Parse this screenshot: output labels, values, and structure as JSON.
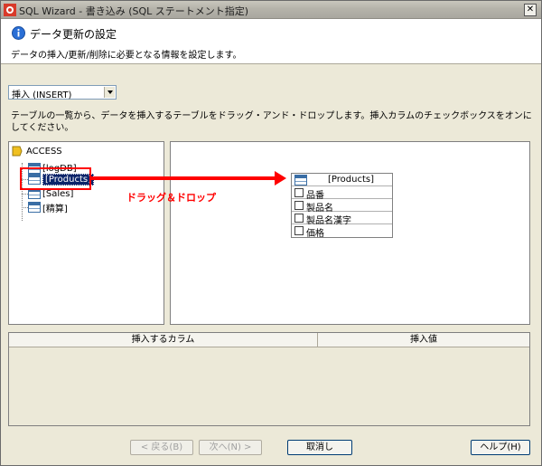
{
  "window": {
    "title": "SQL Wizard - 書き込み (SQL ステートメント指定)",
    "close_label": "✕"
  },
  "header": {
    "heading": "データ更新の設定",
    "description": "データの挿入/更新/削除に必要となる情報を設定します。"
  },
  "operation": {
    "selected": "挿入 (INSERT)"
  },
  "instructions": "テーブルの一覧から、データを挿入するテーブルをドラッグ・アンド・ドロップします。挿入カラムのチェックボックスをオンにしてください。",
  "tree": {
    "root": "ACCESS",
    "items": [
      {
        "label": "[logDB]"
      },
      {
        "label": "[Products]",
        "selected": true
      },
      {
        "label": "[Sales]"
      },
      {
        "label": "[精算]"
      }
    ]
  },
  "annotation": {
    "label": "ドラッグ＆ドロップ",
    "color": "#ff0000"
  },
  "table_box": {
    "title": "[Products]",
    "columns": [
      "品番",
      "製品名",
      "製品名漢字",
      "価格"
    ]
  },
  "grid": {
    "headers": [
      "挿入するカラム",
      "挿入値"
    ]
  },
  "buttons": {
    "back": "< 戻る(B)",
    "next": "次へ(N) >",
    "cancel": "取消し",
    "help": "ヘルプ(H)"
  }
}
